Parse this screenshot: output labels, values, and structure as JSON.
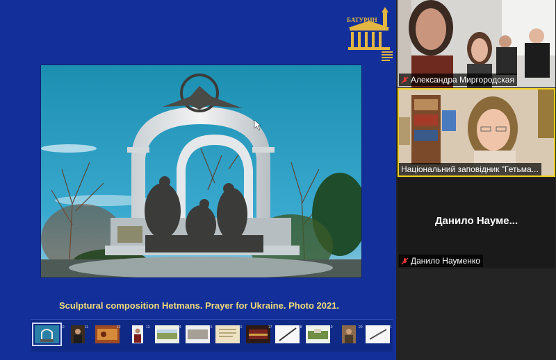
{
  "slide": {
    "caption": "Sculptural composition Hetmans. Prayer for Ukraine. Photo 2021.",
    "logo_text": "БАТУРИН"
  },
  "thumbnails": [
    {
      "number": "10",
      "icon": "monument-thumb-icon",
      "active": true
    },
    {
      "number": "11",
      "icon": "portrait-thumb-icon"
    },
    {
      "number": "12",
      "icon": "painting-thumb-icon"
    },
    {
      "number": "13",
      "icon": "portrait-thumb-icon"
    },
    {
      "number": "14",
      "icon": "landscape-thumb-icon"
    },
    {
      "number": "15",
      "icon": "landscape-thumb-icon"
    },
    {
      "number": "16",
      "icon": "document-thumb-icon"
    },
    {
      "number": "17",
      "icon": "painting-thumb-icon"
    },
    {
      "number": "18",
      "icon": "sword-thumb-icon"
    },
    {
      "number": "19",
      "icon": "landscape-thumb-icon"
    },
    {
      "number": "20",
      "icon": "portrait-thumb-icon"
    },
    {
      "number": "21",
      "icon": "sword-thumb-icon"
    }
  ],
  "participants": [
    {
      "name": "Александра Миргородская",
      "muted": true
    },
    {
      "name": "Національний заповідник \"Гетьма...",
      "muted": false,
      "active_speaker": true
    },
    {
      "name": "Данило Науменко",
      "display_name": "Данило  Науме...",
      "muted": true
    }
  ],
  "colors": {
    "slide_background": "#13309a",
    "caption": "#f0dc78",
    "active_speaker_border": "#f2d21a",
    "muted_icon": "#e53935"
  }
}
